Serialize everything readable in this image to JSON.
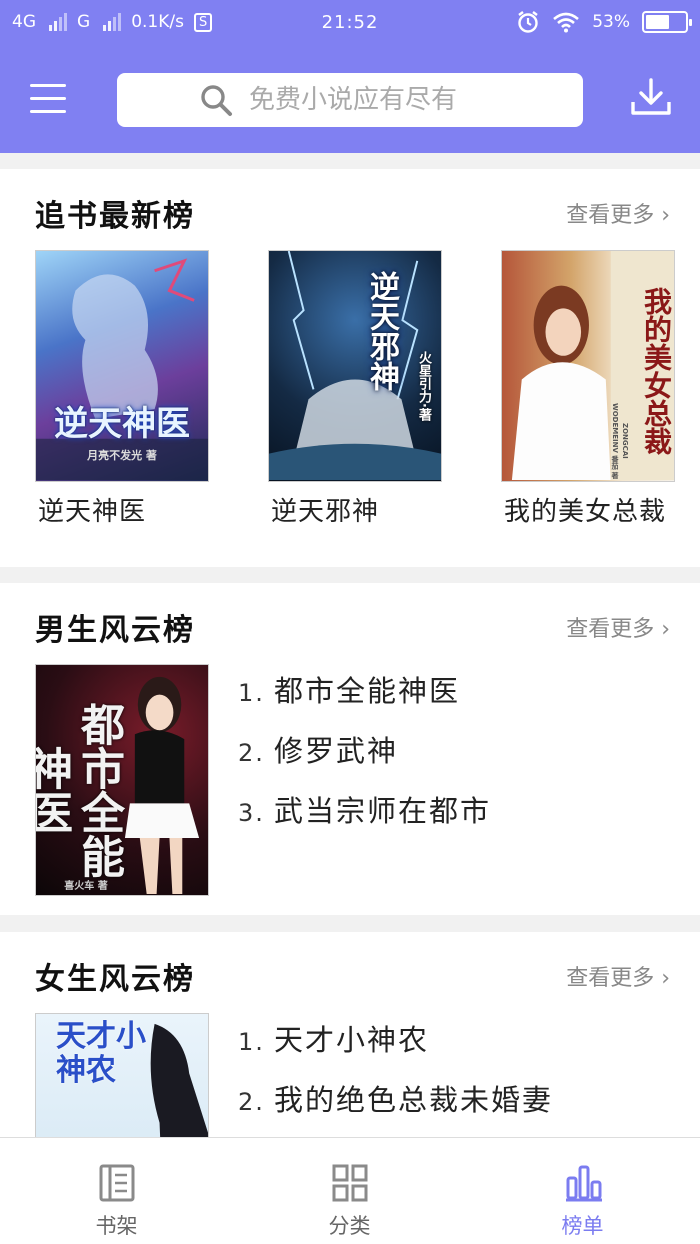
{
  "status_bar": {
    "network_1": "4G",
    "network_2": "G",
    "speed": "0.1K/s",
    "s_badge": "S",
    "time": "21:52",
    "battery": "53%",
    "battery_level": 0.53,
    "icons": [
      "alarm-icon",
      "wifi-icon",
      "battery-icon"
    ]
  },
  "header": {
    "search_placeholder": "免费小说应有尽有",
    "accent_color": "#8080f2"
  },
  "sections": [
    {
      "title": "追书最新榜",
      "more": "查看更多 ›",
      "books": [
        {
          "name": "逆天神医",
          "cover_text": "逆天神医",
          "cover_author": "月亮不发光 著"
        },
        {
          "name": "逆天邪神",
          "cover_text": "逆天邪神",
          "cover_author": "火星引力·著"
        },
        {
          "name": "我的美女总裁",
          "cover_text": "我的美女总裁",
          "cover_author": "ZONGCAI WODEMEINV 番茄 著"
        }
      ]
    },
    {
      "title": "男生风云榜",
      "more": "查看更多 ›",
      "cover_text": "都市全能神医",
      "cover_author": "喜火车 著",
      "items": [
        {
          "num": "1.",
          "name": "都市全能神医"
        },
        {
          "num": "2.",
          "name": "修罗武神"
        },
        {
          "num": "3.",
          "name": "武当宗师在都市"
        }
      ]
    },
    {
      "title": "女生风云榜",
      "more": "查看更多 ›",
      "cover_text": "天才小神农",
      "items": [
        {
          "num": "1.",
          "name": "天才小神农"
        },
        {
          "num": "2.",
          "name": "我的绝色总裁未婚妻"
        }
      ]
    }
  ],
  "bottom_nav": [
    {
      "label": "书架",
      "icon": "bookshelf-icon"
    },
    {
      "label": "分类",
      "icon": "category-grid-icon"
    },
    {
      "label": "榜单",
      "icon": "ranking-bars-icon",
      "active": true
    }
  ]
}
